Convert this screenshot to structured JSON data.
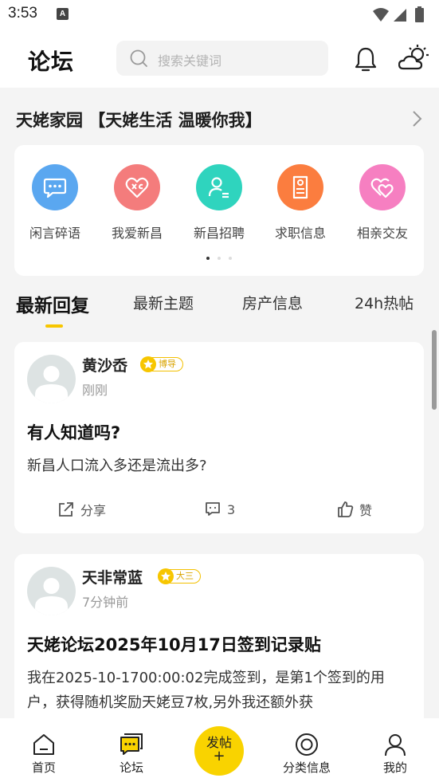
{
  "status_bar": {
    "time": "3:53",
    "notification_icon": "A"
  },
  "header": {
    "title": "论坛",
    "search_placeholder": "搜索关键词"
  },
  "community": {
    "title": "天姥家园 【天姥生活 温暖你我】"
  },
  "categories": [
    {
      "label": "闲言碎语",
      "icon": "chat-icon",
      "color": "#5aa7f0"
    },
    {
      "label": "我爱新昌",
      "icon": "heart-icon",
      "color": "#f47c7c"
    },
    {
      "label": "新昌招聘",
      "icon": "person-card-icon",
      "color": "#2fd4be"
    },
    {
      "label": "求职信息",
      "icon": "document-icon",
      "color": "#fb7d3f"
    },
    {
      "label": "相亲交友",
      "icon": "double-heart-icon",
      "color": "#f67fc1"
    }
  ],
  "tabs": [
    {
      "label": "最新回复",
      "active": true
    },
    {
      "label": "最新主题",
      "active": false
    },
    {
      "label": "房产信息",
      "active": false
    },
    {
      "label": "24h热帖",
      "active": false
    }
  ],
  "posts": [
    {
      "author": "黄沙岙",
      "badge": "博导",
      "time": "刚刚",
      "title": "有人知道吗?",
      "body": "新昌人口流入多还是流出多?",
      "share_label": "分享",
      "comment_count": "3",
      "like_label": "赞"
    },
    {
      "author": "天非常蓝",
      "badge": "大三",
      "time": "7分钟前",
      "title": "天姥论坛2025年10月17日签到记录贴",
      "body": "我在2025-10-1700:00:02完成签到，是第1个签到的用户，获得随机奖励天姥豆7枚,另外我还额外获"
    }
  ],
  "bottom_nav": {
    "home": "首页",
    "forum": "论坛",
    "publish": "发帖",
    "publish_plus": "+",
    "category": "分类信息",
    "mine": "我的"
  },
  "colors": {
    "accent": "#f7c600",
    "background": "#f4f4f4"
  }
}
